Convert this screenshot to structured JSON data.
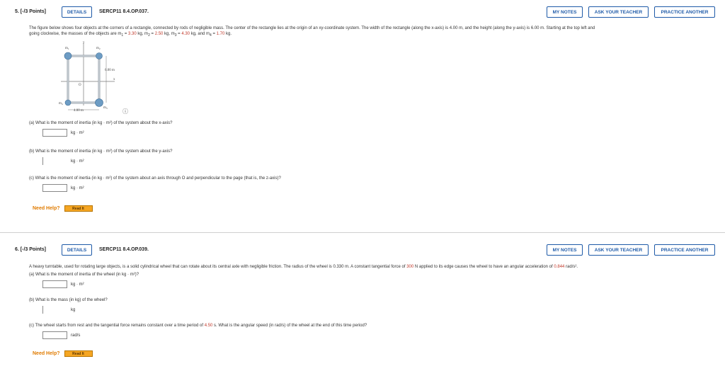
{
  "problem1": {
    "number": "5. [-/3 Points]",
    "details_label": "DETAILS",
    "code": "SERCP11 8.4.OP.037.",
    "my_notes": "MY NOTES",
    "ask_teacher": "ASK YOUR TEACHER",
    "practice_another": "PRACTICE ANOTHER",
    "intro_line1": "The figure below shows four objects at the corners of a rectangle, connected by rods of negligible mass. The center of the rectangle lies at the origin of an xy-coordinate system. The width of the rectangle (along the x-axis) is 4.00 m, and the height (along the y-axis) is 6.00 m. Starting at the top left and",
    "intro_line2a": "going clockwise, the masses of the objects are m",
    "intro_line2b": " = ",
    "m1": "3.30",
    "m2": "2.50",
    "m3": "4.30",
    "m4": "1.70",
    "figure": {
      "labels": [
        "m",
        "m",
        "m",
        "m"
      ],
      "subs": [
        "1",
        "2",
        "3",
        "4"
      ],
      "y_label": "y",
      "x_label": "x",
      "o_label": "O",
      "height_label": "6.00 m",
      "width_label": "4.00 m"
    },
    "part_a": "(a)  What is the moment of inertia (in kg · m²) of the system about the x-axis?",
    "part_b": "(b)  What is the moment of inertia (in kg · m²) of the system about the y-axis?",
    "part_c": "(c)  What is the moment of inertia (in kg · m²) of the system about an axis through O and perpendicular to the page (that is, the z-axis)?",
    "unit_kgm2": "kg · m²",
    "need_help": "Need Help?",
    "read_it": "Read It"
  },
  "problem2": {
    "number": "6. [-/3 Points]",
    "details_label": "DETAILS",
    "code": "SERCP11 8.4.OP.039.",
    "my_notes": "MY NOTES",
    "ask_teacher": "ASK YOUR TEACHER",
    "practice_another": "PRACTICE ANOTHER",
    "intro_pre": "A heavy turntable, used for rotating large objects, is a solid cylindrical wheel that can rotate about its central axle with negligible friction. The radius of the wheel is 0.330 m. A constant tangential force of ",
    "force": "300",
    "intro_mid": " N applied to its edge causes the wheel to have an angular acceleration of ",
    "accel": "0.844",
    "intro_post": " rad/s².",
    "part_a": "(a)  What is the moment of inertia of the wheel (in kg · m²)?",
    "part_b": "(b)  What is the mass (in kg) of the wheel?",
    "part_c_pre": "(c)  The wheel starts from rest and the tangential force remains constant over a time period of ",
    "time": "4.50",
    "part_c_post": " s. What is the angular speed (in rad/s) of the wheel at the end of this time period?",
    "unit_a": "kg · m²",
    "unit_b": "kg",
    "unit_c": "rad/s",
    "need_help": "Need Help?",
    "read_it": "Read It"
  }
}
